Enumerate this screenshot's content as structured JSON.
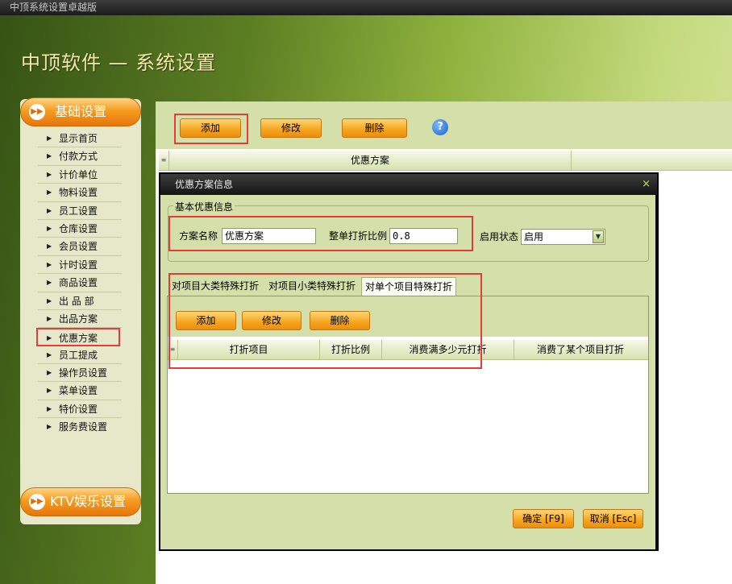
{
  "window": {
    "title": "中顶系统设置卓越版"
  },
  "app": {
    "title": "中顶软件 — 系统设置"
  },
  "sidebar": {
    "group1": "基础设置",
    "group2": "KTV娱乐设置",
    "items": [
      {
        "label": "显示首页"
      },
      {
        "label": "付款方式"
      },
      {
        "label": "计价单位"
      },
      {
        "label": "物料设置"
      },
      {
        "label": "员工设置"
      },
      {
        "label": "仓库设置"
      },
      {
        "label": "会员设置"
      },
      {
        "label": "计时设置"
      },
      {
        "label": "商品设置"
      },
      {
        "label": "出 品 部"
      },
      {
        "label": "出品方案"
      },
      {
        "label": "优惠方案"
      },
      {
        "label": "员工提成"
      },
      {
        "label": "操作员设置"
      },
      {
        "label": "菜单设置"
      },
      {
        "label": "特价设置"
      },
      {
        "label": "服务费设置"
      }
    ],
    "active_index": 11
  },
  "toolbar": {
    "add": "添加",
    "edit": "修改",
    "delete": "删除",
    "help": "?"
  },
  "grid": {
    "columns": [
      "优惠方案",
      ""
    ]
  },
  "dialog": {
    "title": "优惠方案信息",
    "close": "×",
    "fieldset": "基本优惠信息",
    "name_label": "方案名称",
    "name_value": "优惠方案",
    "ratio_label": "整单打折比例",
    "ratio_value": "0.8",
    "status_label": "启用状态",
    "status_value": "启用",
    "tabs": [
      "对项目大类特殊打折",
      "对项目小类特殊打折",
      "对单个项目特殊打折"
    ],
    "active_tab": 2,
    "sub_toolbar": {
      "add": "添加",
      "edit": "修改",
      "delete": "删除"
    },
    "sub_columns": [
      "打折项目",
      "打折比例",
      "消费满多少元打折",
      "消费了某个项目打折"
    ],
    "ok": "确定 [F9]",
    "cancel": "取消 [Esc]"
  },
  "colors": {
    "accent": "#f6a41c",
    "highlight": "#e43b3b",
    "panel": "#d4dfa9"
  }
}
